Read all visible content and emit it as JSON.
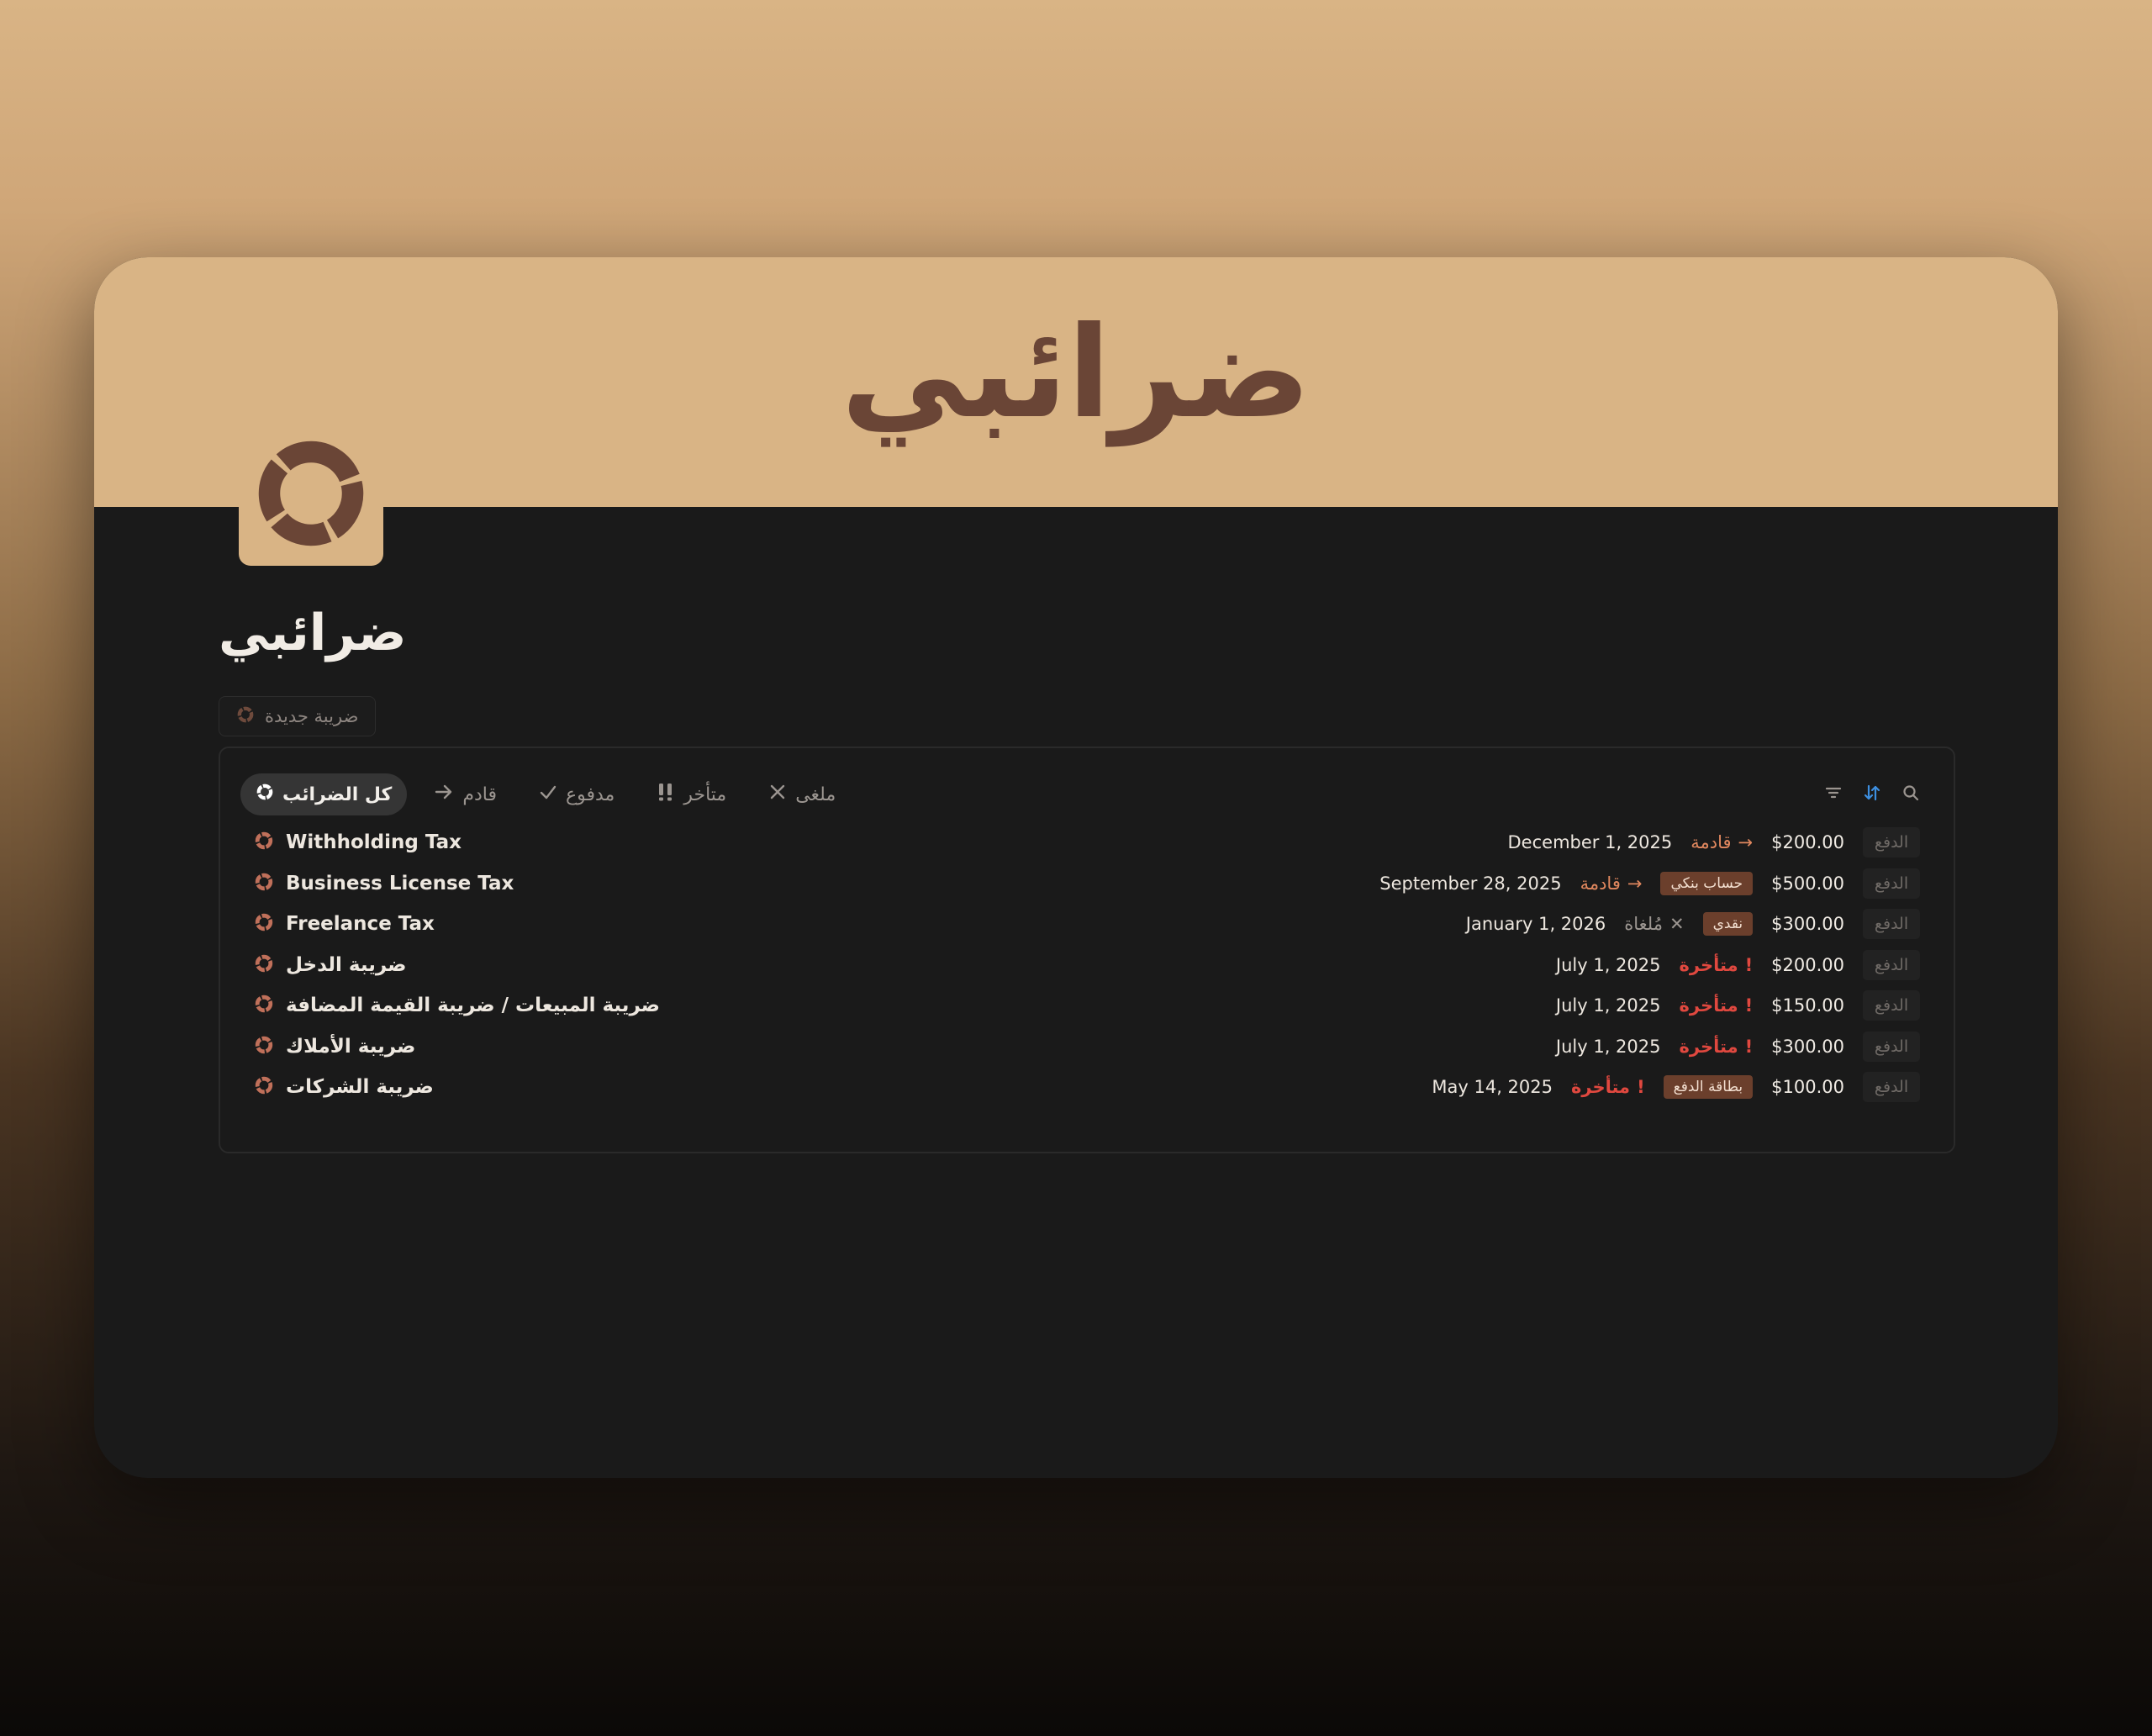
{
  "banner": {
    "title": "ضرائبي"
  },
  "page": {
    "title": "ضرائبي",
    "icon": "donut-chart-icon"
  },
  "new_button": {
    "label": "ضريبة جديدة"
  },
  "tabs": [
    {
      "label": "كل الضرائب",
      "icon": "donut-icon",
      "active": true
    },
    {
      "label": "قادم",
      "icon": "arrow-right-icon",
      "active": false
    },
    {
      "label": "مدفوع",
      "icon": "check-icon",
      "active": false
    },
    {
      "label": "متأخر",
      "icon": "double-exclamation-icon",
      "active": false
    },
    {
      "label": "ملغى",
      "icon": "x-icon",
      "active": false
    }
  ],
  "toolbar": {
    "filter_icon": "filter-icon",
    "sort_icon": "sort-icon",
    "search_icon": "search-icon"
  },
  "rows": [
    {
      "name": "Withholding Tax",
      "amount": "$200.00",
      "method": "",
      "status": "قادمة",
      "status_type": "upcoming",
      "date": "December 1, 2025",
      "pay": "الدفع"
    },
    {
      "name": "Business License Tax",
      "amount": "$500.00",
      "method": "حساب بنكي",
      "status": "قادمة",
      "status_type": "upcoming",
      "date": "September 28, 2025",
      "pay": "الدفع"
    },
    {
      "name": "Freelance Tax",
      "amount": "$300.00",
      "method": "نقدي",
      "status": "مُلغاة",
      "status_type": "cancel",
      "date": "January 1, 2026",
      "pay": "الدفع"
    },
    {
      "name": "ضريبة الدخل",
      "amount": "$200.00",
      "method": "",
      "status": "متأخرة",
      "status_type": "late",
      "date": "July 1, 2025",
      "pay": "الدفع"
    },
    {
      "name": "ضريبة المبيعات / ضريبة القيمة المضافة",
      "amount": "$150.00",
      "method": "",
      "status": "متأخرة",
      "status_type": "late",
      "date": "July 1, 2025",
      "pay": "الدفع"
    },
    {
      "name": "ضريبة الأملاك",
      "amount": "$300.00",
      "method": "",
      "status": "متأخرة",
      "status_type": "late",
      "date": "July 1, 2025",
      "pay": "الدفع"
    },
    {
      "name": "ضريبة الشركات",
      "amount": "$100.00",
      "method": "بطاقة الدفع",
      "status": "متأخرة",
      "status_type": "late",
      "date": "May 14, 2025",
      "pay": "الدفع"
    }
  ],
  "colors": {
    "banner": "#d9b485",
    "brand_brown": "#6a4536",
    "late": "#e0483f",
    "upcoming": "#e0875e",
    "method_tag": "#6b3f2c",
    "card_bg": "#1a1a1a"
  }
}
